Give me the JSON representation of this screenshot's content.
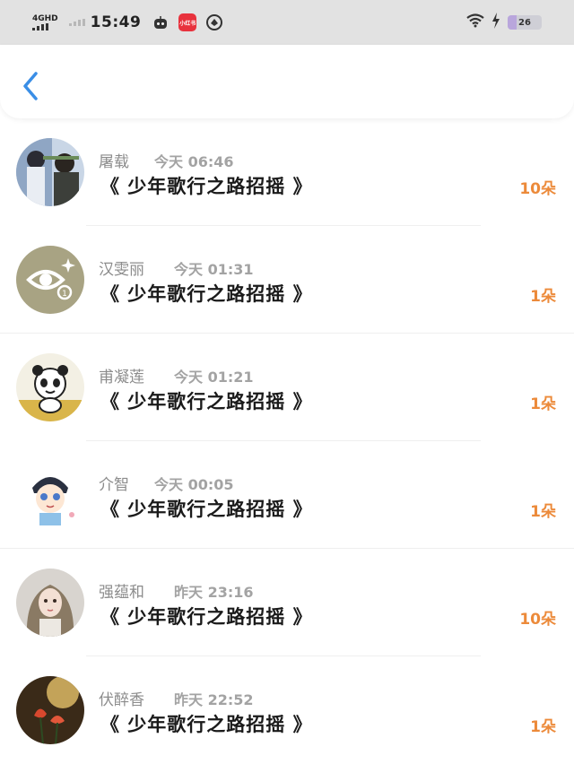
{
  "status_bar": {
    "network": "4GHD",
    "time": "15:49",
    "app_icon_text": "小红书",
    "battery": "26"
  },
  "nav": {
    "back_icon": "chevron-left-icon"
  },
  "gift_list": [
    {
      "name": "屠载",
      "time": "今天 06:46",
      "title": "《 少年歌行之路招摇 》",
      "count": "10朵",
      "avatar": "photo-avatar"
    },
    {
      "name": "汉雯丽",
      "time": "今天 01:31",
      "title": "《 少年歌行之路招摇 》",
      "count": "1朵",
      "avatar": "eye-logo-avatar"
    },
    {
      "name": "甫凝莲",
      "time": "今天 01:21",
      "title": "《 少年歌行之路招摇 》",
      "count": "1朵",
      "avatar": "panda-avatar"
    },
    {
      "name": "介智",
      "time": "今天 00:05",
      "title": "《 少年歌行之路招摇 》",
      "count": "1朵",
      "avatar": "cartoon-boy-avatar"
    },
    {
      "name": "强蕴和",
      "time": "昨天 23:16",
      "title": "《 少年歌行之路招摇 》",
      "count": "10朵",
      "avatar": "girl-avatar"
    },
    {
      "name": "伏醉香",
      "time": "昨天 22:52",
      "title": "《 少年歌行之路招摇 》",
      "count": "1朵",
      "avatar": "flower-avatar"
    }
  ],
  "colors": {
    "accent_orange": "#ec8a3a",
    "back_blue": "#3a8ee6"
  }
}
